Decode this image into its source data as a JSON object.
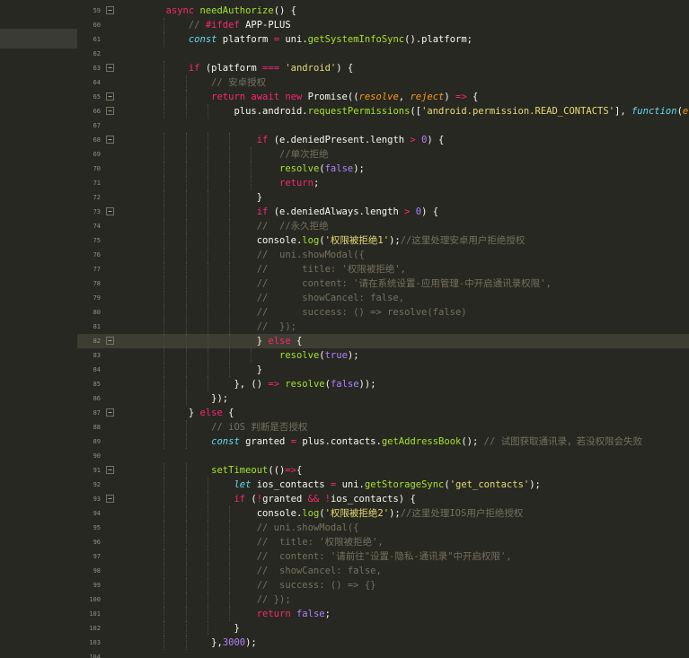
{
  "editor": {
    "lines": [
      {
        "n": "59",
        "fold": "−",
        "indent": 4,
        "tokens": [
          [
            "kw",
            "async "
          ],
          [
            "fn",
            "needAuthorize"
          ],
          [
            "pl",
            "() {"
          ]
        ]
      },
      {
        "n": "60",
        "fold": "",
        "indent": 6,
        "tokens": [
          [
            "cm",
            "// "
          ],
          [
            "kw",
            "#ifdef "
          ],
          [
            "pl",
            "APP-PLUS"
          ]
        ]
      },
      {
        "n": "61",
        "fold": "",
        "indent": 6,
        "tokens": [
          [
            "ty",
            "const "
          ],
          [
            "pl",
            "platform "
          ],
          [
            "kw",
            "= "
          ],
          [
            "pl",
            "uni."
          ],
          [
            "fn",
            "getSystemInfoSync"
          ],
          [
            "pl",
            "().platform;"
          ]
        ]
      },
      {
        "n": "62",
        "fold": "",
        "indent": 0,
        "tokens": []
      },
      {
        "n": "63",
        "fold": "−",
        "indent": 6,
        "tokens": [
          [
            "kw",
            "if "
          ],
          [
            "pl",
            "(platform "
          ],
          [
            "kw",
            "=== "
          ],
          [
            "st",
            "'android'"
          ],
          [
            "pl",
            ") {"
          ]
        ]
      },
      {
        "n": "64",
        "fold": "",
        "indent": 8,
        "tokens": [
          [
            "cm",
            "// 安卓授权"
          ]
        ]
      },
      {
        "n": "65",
        "fold": "−",
        "indent": 8,
        "tokens": [
          [
            "kw",
            "return await new "
          ],
          [
            "pl",
            "Promise(("
          ],
          [
            "pa",
            "resolve"
          ],
          [
            "pl",
            ", "
          ],
          [
            "pa",
            "reject"
          ],
          [
            "pl",
            ") "
          ],
          [
            "kw",
            "=> "
          ],
          [
            "pl",
            "{"
          ]
        ]
      },
      {
        "n": "66",
        "fold": "−",
        "indent": 10,
        "tokens": [
          [
            "pl",
            "plus.android."
          ],
          [
            "fn",
            "requestPermissions"
          ],
          [
            "pl",
            "(["
          ],
          [
            "st",
            "'android.permission.READ_CONTACTS'"
          ],
          [
            "pl",
            "], "
          ],
          [
            "ty",
            "function"
          ],
          [
            "pl",
            "("
          ],
          [
            "pa",
            "e"
          ],
          [
            "pl",
            ") {"
          ]
        ]
      },
      {
        "n": "67",
        "fold": "",
        "indent": 0,
        "tokens": []
      },
      {
        "n": "68",
        "fold": "−",
        "indent": 12,
        "tokens": [
          [
            "kw",
            "if "
          ],
          [
            "pl",
            "(e.deniedPresent.length "
          ],
          [
            "kw",
            "> "
          ],
          [
            "num",
            "0"
          ],
          [
            "pl",
            ") {"
          ]
        ]
      },
      {
        "n": "69",
        "fold": "",
        "indent": 14,
        "tokens": [
          [
            "cm",
            "//单次拒绝"
          ]
        ]
      },
      {
        "n": "70",
        "fold": "",
        "indent": 14,
        "tokens": [
          [
            "fn",
            "resolve"
          ],
          [
            "pl",
            "("
          ],
          [
            "num",
            "false"
          ],
          [
            "pl",
            ");"
          ]
        ]
      },
      {
        "n": "71",
        "fold": "",
        "indent": 14,
        "tokens": [
          [
            "kw",
            "return"
          ],
          [
            "pl",
            ";"
          ]
        ]
      },
      {
        "n": "72",
        "fold": "",
        "indent": 12,
        "tokens": [
          [
            "pl",
            "}"
          ]
        ]
      },
      {
        "n": "73",
        "fold": "−",
        "indent": 12,
        "tokens": [
          [
            "kw",
            "if "
          ],
          [
            "pl",
            "(e.deniedAlways.length "
          ],
          [
            "kw",
            "> "
          ],
          [
            "num",
            "0"
          ],
          [
            "pl",
            ") {"
          ]
        ]
      },
      {
        "n": "74",
        "fold": "",
        "indent": 12,
        "tokens": [
          [
            "cm",
            "//  //永久拒绝"
          ]
        ]
      },
      {
        "n": "75",
        "fold": "",
        "indent": 12,
        "tokens": [
          [
            "pl",
            "console."
          ],
          [
            "fn",
            "log"
          ],
          [
            "pl",
            "("
          ],
          [
            "st",
            "'权限被拒绝1'"
          ],
          [
            "pl",
            ");"
          ],
          [
            "cm",
            "//这里处理安卓用户拒绝授权"
          ]
        ]
      },
      {
        "n": "76",
        "fold": "",
        "indent": 12,
        "tokens": [
          [
            "cm",
            "//  uni.showModal({"
          ]
        ]
      },
      {
        "n": "77",
        "fold": "",
        "indent": 12,
        "tokens": [
          [
            "cm",
            "//      title: '权限被拒绝',"
          ]
        ]
      },
      {
        "n": "78",
        "fold": "",
        "indent": 12,
        "tokens": [
          [
            "cm",
            "//      content: '请在系统设置-应用管理-中开启通讯录权限',"
          ]
        ]
      },
      {
        "n": "79",
        "fold": "",
        "indent": 12,
        "tokens": [
          [
            "cm",
            "//      showCancel: false,"
          ]
        ]
      },
      {
        "n": "80",
        "fold": "",
        "indent": 12,
        "tokens": [
          [
            "cm",
            "//      success: () => resolve(false)"
          ]
        ]
      },
      {
        "n": "81",
        "fold": "",
        "indent": 12,
        "tokens": [
          [
            "cm",
            "//  });"
          ]
        ]
      },
      {
        "n": "82",
        "fold": "−",
        "indent": 12,
        "hl": true,
        "tokens": [
          [
            "pl",
            "} "
          ],
          [
            "kw",
            "else "
          ],
          [
            "pl",
            "{"
          ]
        ]
      },
      {
        "n": "83",
        "fold": "",
        "indent": 14,
        "tokens": [
          [
            "fn",
            "resolve"
          ],
          [
            "pl",
            "("
          ],
          [
            "num",
            "true"
          ],
          [
            "pl",
            ");"
          ]
        ]
      },
      {
        "n": "84",
        "fold": "",
        "indent": 12,
        "tokens": [
          [
            "pl",
            "}"
          ]
        ]
      },
      {
        "n": "85",
        "fold": "",
        "indent": 10,
        "tokens": [
          [
            "pl",
            "}, () "
          ],
          [
            "kw",
            "=> "
          ],
          [
            "fn",
            "resolve"
          ],
          [
            "pl",
            "("
          ],
          [
            "num",
            "false"
          ],
          [
            "pl",
            "));"
          ]
        ]
      },
      {
        "n": "86",
        "fold": "",
        "indent": 8,
        "tokens": [
          [
            "pl",
            "});"
          ]
        ]
      },
      {
        "n": "87",
        "fold": "−",
        "indent": 6,
        "tokens": [
          [
            "pl",
            "} "
          ],
          [
            "kw",
            "else "
          ],
          [
            "pl",
            "{"
          ]
        ]
      },
      {
        "n": "88",
        "fold": "",
        "indent": 8,
        "tokens": [
          [
            "cm",
            "// iOS 判断是否授权"
          ]
        ]
      },
      {
        "n": "89",
        "fold": "",
        "indent": 8,
        "tokens": [
          [
            "ty",
            "const "
          ],
          [
            "pl",
            "granted "
          ],
          [
            "kw",
            "= "
          ],
          [
            "pl",
            "plus.contacts."
          ],
          [
            "fn",
            "getAddressBook"
          ],
          [
            "pl",
            "(); "
          ],
          [
            "cm",
            "// 试图获取通讯录，若没权限会失败"
          ]
        ]
      },
      {
        "n": "90",
        "fold": "",
        "indent": 0,
        "tokens": []
      },
      {
        "n": "91",
        "fold": "−",
        "indent": 8,
        "tokens": [
          [
            "fn",
            "setTimeout"
          ],
          [
            "pl",
            "(()"
          ],
          [
            "kw",
            "=>"
          ],
          [
            "pl",
            "{"
          ]
        ]
      },
      {
        "n": "92",
        "fold": "",
        "indent": 10,
        "tokens": [
          [
            "ty",
            "let "
          ],
          [
            "pl",
            "ios_contacts "
          ],
          [
            "kw",
            "= "
          ],
          [
            "pl",
            "uni."
          ],
          [
            "fn",
            "getStorageSync"
          ],
          [
            "pl",
            "("
          ],
          [
            "st",
            "'get_contacts'"
          ],
          [
            "pl",
            ");"
          ]
        ]
      },
      {
        "n": "93",
        "fold": "−",
        "indent": 10,
        "tokens": [
          [
            "kw",
            "if "
          ],
          [
            "pl",
            "("
          ],
          [
            "kw",
            "!"
          ],
          [
            "pl",
            "granted "
          ],
          [
            "kw",
            "&& !"
          ],
          [
            "pl",
            "ios_contacts) {"
          ]
        ]
      },
      {
        "n": "94",
        "fold": "",
        "indent": 12,
        "tokens": [
          [
            "pl",
            "console."
          ],
          [
            "fn",
            "log"
          ],
          [
            "pl",
            "("
          ],
          [
            "st",
            "'权限被拒绝2'"
          ],
          [
            "pl",
            ");"
          ],
          [
            "cm",
            "//这里处理IOS用户拒绝授权"
          ]
        ]
      },
      {
        "n": "95",
        "fold": "",
        "indent": 12,
        "tokens": [
          [
            "cm",
            "// uni.showModal({"
          ]
        ]
      },
      {
        "n": "96",
        "fold": "",
        "indent": 12,
        "tokens": [
          [
            "cm",
            "//  title: '权限被拒绝',"
          ]
        ]
      },
      {
        "n": "97",
        "fold": "",
        "indent": 12,
        "tokens": [
          [
            "cm",
            "//  content: '请前往\"设置-隐私-通讯录\"中开启权限',"
          ]
        ]
      },
      {
        "n": "98",
        "fold": "",
        "indent": 12,
        "tokens": [
          [
            "cm",
            "//  showCancel: false,"
          ]
        ]
      },
      {
        "n": "99",
        "fold": "",
        "indent": 12,
        "tokens": [
          [
            "cm",
            "//  success: () => {}"
          ]
        ]
      },
      {
        "n": "100",
        "fold": "",
        "indent": 12,
        "tokens": [
          [
            "cm",
            "// });"
          ]
        ]
      },
      {
        "n": "101",
        "fold": "",
        "indent": 12,
        "tokens": [
          [
            "kw",
            "return "
          ],
          [
            "num",
            "false"
          ],
          [
            "pl",
            ";"
          ]
        ]
      },
      {
        "n": "102",
        "fold": "",
        "indent": 10,
        "tokens": [
          [
            "pl",
            "}"
          ]
        ]
      },
      {
        "n": "103",
        "fold": "",
        "indent": 8,
        "tokens": [
          [
            "pl",
            "},"
          ],
          [
            "num",
            "3000"
          ],
          [
            "pl",
            ");"
          ]
        ]
      },
      {
        "n": "104",
        "fold": "",
        "indent": 0,
        "tokens": []
      }
    ]
  }
}
